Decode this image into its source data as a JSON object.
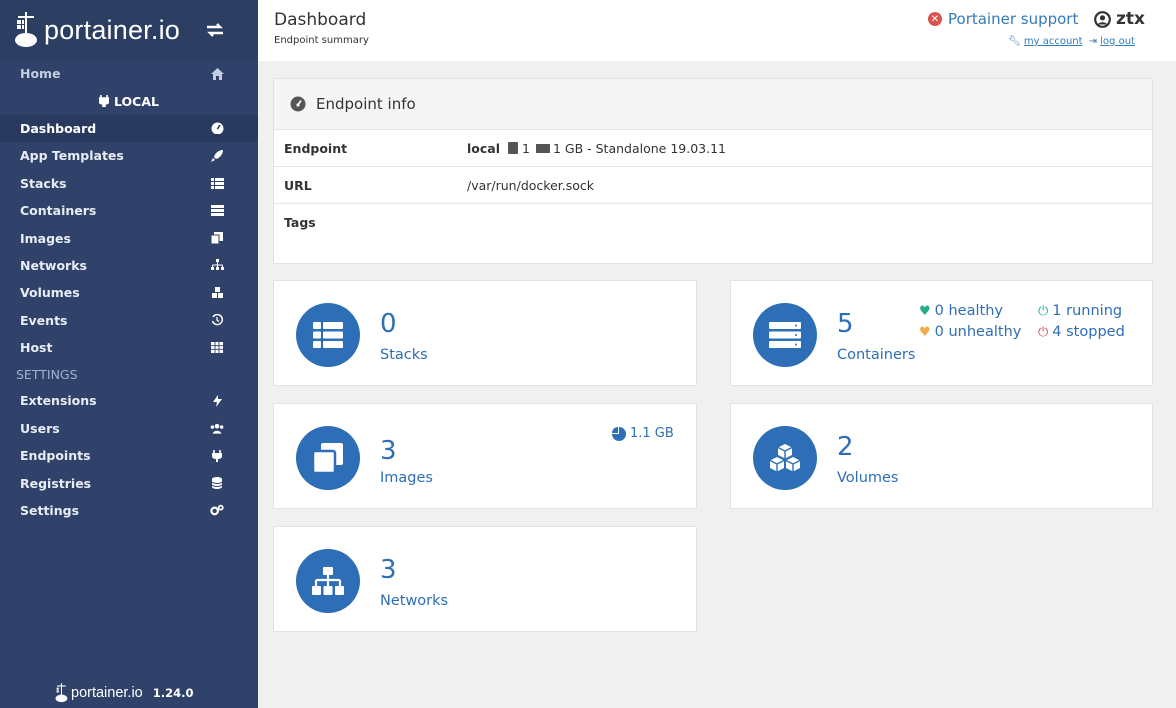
{
  "brand": {
    "name": "portainer.io",
    "version": "1.24.0"
  },
  "sidebar": {
    "home": "Home",
    "endpoint": "LOCAL",
    "items": [
      {
        "label": "Dashboard",
        "icon": "tachometer-icon"
      },
      {
        "label": "App Templates",
        "icon": "rocket-icon"
      },
      {
        "label": "Stacks",
        "icon": "th-list-icon"
      },
      {
        "label": "Containers",
        "icon": "server-icon"
      },
      {
        "label": "Images",
        "icon": "clone-icon"
      },
      {
        "label": "Networks",
        "icon": "sitemap-icon"
      },
      {
        "label": "Volumes",
        "icon": "cubes-icon"
      },
      {
        "label": "Events",
        "icon": "history-icon"
      },
      {
        "label": "Host",
        "icon": "th-icon"
      }
    ],
    "settings_title": "SETTINGS",
    "settings_items": [
      {
        "label": "Extensions",
        "icon": "bolt-icon"
      },
      {
        "label": "Users",
        "icon": "users-icon"
      },
      {
        "label": "Endpoints",
        "icon": "plug-icon"
      },
      {
        "label": "Registries",
        "icon": "database-icon"
      },
      {
        "label": "Settings",
        "icon": "cogs-icon"
      }
    ]
  },
  "header": {
    "title": "Dashboard",
    "subtitle": "Endpoint summary",
    "support": "Portainer support",
    "username": "ztx",
    "my_account": "my account",
    "log_out": "log out"
  },
  "endpoint_info": {
    "title": "Endpoint info",
    "rows": {
      "endpoint_label": "Endpoint",
      "endpoint_name": "local",
      "cpu": "1",
      "memory": "1 GB - Standalone 19.03.11",
      "url_label": "URL",
      "url": "/var/run/docker.sock",
      "tags_label": "Tags"
    }
  },
  "tiles": {
    "stacks": {
      "count": "0",
      "label": "Stacks"
    },
    "containers": {
      "count": "5",
      "label": "Containers",
      "healthy": "0 healthy",
      "unhealthy": "0 unhealthy",
      "running": "1 running",
      "stopped": "4 stopped"
    },
    "images": {
      "count": "3",
      "label": "Images",
      "size": "1.1 GB"
    },
    "volumes": {
      "count": "2",
      "label": "Volumes"
    },
    "networks": {
      "count": "3",
      "label": "Networks"
    }
  },
  "colors": {
    "sidebar": "#30426a",
    "accent": "#2e6eb6",
    "healthy": "#23ae89",
    "unhealthy": "#f0ad4e",
    "stopped": "#d9534f"
  }
}
